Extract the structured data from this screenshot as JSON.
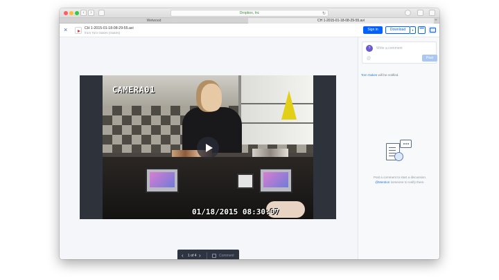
{
  "browser": {
    "address": "Dropbox, Inc",
    "tabs": [
      "Wetwood",
      "CH 1-2015-01-18-08-29-55.avi"
    ],
    "new_tab_label": "+",
    "back": "‹",
    "forward": "›",
    "reload": "↻"
  },
  "header": {
    "close_icon": "×",
    "file_name": "CH 1-2015-01-18-08-29-55.avi",
    "file_owner": "from Tom Oakes (Oakes)",
    "signin_label": "Sign in",
    "download_label": "Download",
    "download_caret": "▾",
    "more_label": "•••"
  },
  "video": {
    "camera_label": "CAMERA01",
    "timestamp": "01/18/2015 08:30:07"
  },
  "pager": {
    "prev": "‹",
    "next": "›",
    "page_text": "1 of 4",
    "comment_label": "Comment"
  },
  "comments": {
    "avatar_initial": "?",
    "input_placeholder": "Write a comment",
    "at_button": "@",
    "post_label": "Post",
    "notify_name": "Tom Oakes",
    "notify_text": " will be notified.",
    "empty_line1": "Post a comment to start a discussion.",
    "empty_mention": "@Mention",
    "empty_line2": " someone to notify them."
  },
  "footer": {
    "flag_icon": "⚑"
  },
  "colors": {
    "accent": "#0061fe",
    "pager_bg": "#2e3440",
    "video_bg": "#2d323b"
  }
}
